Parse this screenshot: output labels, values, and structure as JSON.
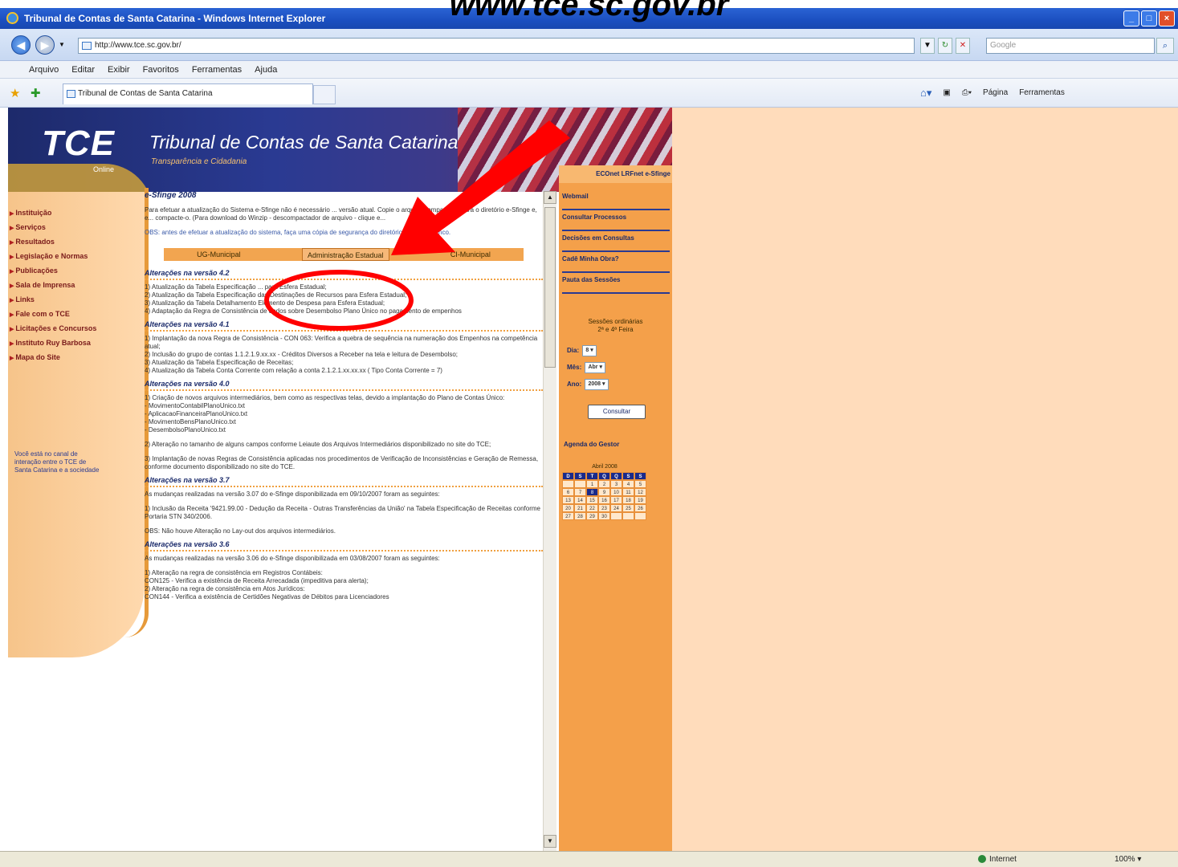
{
  "slide": {
    "caption": "www.tce.sc.gov.br"
  },
  "window": {
    "title": "Tribunal de Contas de Santa Catarina - Windows Internet Explorer",
    "min": "_",
    "max": "□",
    "close": "×"
  },
  "addressbar": {
    "url": "http://www.tce.sc.gov.br/",
    "search_placeholder": "Google"
  },
  "menu": [
    "Arquivo",
    "Editar",
    "Exibir",
    "Favoritos",
    "Ferramentas",
    "Ajuda"
  ],
  "tab": {
    "label": "Tribunal de Contas de Santa Catarina"
  },
  "commandbar": {
    "page": "Página",
    "tools": "Ferramentas"
  },
  "site": {
    "logo": "TCE",
    "online": "Online",
    "title": "Tribunal de Contas de Santa Catarina",
    "subtitle": "Transparência e Cidadania",
    "left_nav": [
      "Instituição",
      "Serviços",
      "Resultados",
      "Legislação e Normas",
      "Publicações",
      "Sala de Imprensa",
      "Links",
      "Fale com o TCE",
      "Licitações e Concursos",
      "Instituto Ruy Barbosa",
      "Mapa do Site"
    ],
    "left_message": "Você está no canal de interação entre o TCE de Santa Catarina e a sociedade",
    "content": {
      "title": "e-Sfinge 2008",
      "intro": "Para efetuar a atualização do Sistema e-Sfinge não é necessário ... versão atual. Copie o arquivo compactado para o diretório e-Sfinge e, e... compacte-o. (Para download do Winzip - descompactador de arquivo - clique e...",
      "obs": "OBS: antes de efetuar a atualização do sistema, faça uma cópia de segurança do diretório E-Sfinge/Banco.",
      "tabs": [
        "UG-Municipal",
        "Administração Estadual",
        "CI-Municipal"
      ],
      "sections": [
        {
          "heading": "Alterações na versão 4.2",
          "lines": [
            "1) Atualização da Tabela Especificação ... para Esfera Estadual;",
            "2) Atualização da Tabela Especificação das Destinações de Recursos para Esfera Estadual;",
            "3) Atualização da Tabela Detalhamento Elemento de Despesa para Esfera Estadual;",
            "4) Adaptação da Regra de Consistência de dados sobre Desembolso Plano Único no pagamento de empenhos"
          ]
        },
        {
          "heading": "Alterações na versão 4.1",
          "lines": [
            "1) Implantação da nova Regra de Consistência - CON 063: Verifica a quebra de sequência na numeração dos Empenhos na competência atual;",
            "2) Inclusão do grupo de contas 1.1.2.1.9.xx.xx - Créditos Diversos a Receber na tela e leitura de Desembolso;",
            "3) Atualização da Tabela Especificação de Receitas;",
            "4) Atualização da Tabela Conta Corrente com relação a conta 2.1.2.1.xx.xx.xx ( Tipo Conta Corrente = 7)"
          ]
        },
        {
          "heading": "Alterações na versão 4.0",
          "lines": [
            "1) Criação de novos arquivos intermediários, bem como as respectivas telas, devido a implantação do Plano de Contas Único:",
            "- MovimentoContabilPlanoUnico.txt",
            "- AplicacaoFinanceiraPlanoUnico.txt",
            "- MovimentoBensPlanoUnico.txt",
            "- DesembolsoPlanoUnico.txt",
            "",
            "2) Alteração no tamanho de alguns campos conforme Leiaute dos Arquivos Intermediários disponibilizado no site do TCE;",
            "",
            "3) Implantação de novas Regras de Consistência aplicadas nos procedimentos de Verificação de Inconsistências e Geração de Remessa, conforme documento disponibilizado no site do TCE."
          ]
        },
        {
          "heading": "Alterações na versão 3.7",
          "lines": [
            "As mudanças realizadas na versão 3.07 do e-Sfinge disponibilizada em 09/10/2007 foram as seguintes:",
            "",
            "1) Inclusão da Receita '9421.99.00 - Dedução da Receita - Outras Transferências da União' na Tabela Especificação de Receitas conforme Portaria STN 340/2006.",
            "",
            "OBS: Não houve Alteração no Lay-out dos arquivos intermediários."
          ]
        },
        {
          "heading": "Alterações na versão 3.6",
          "lines": [
            "As mudanças realizadas na versão 3.06 do e-Sfinge disponibilizada em 03/08/2007 foram as seguintes:",
            "",
            "1) Alteração na regra de consistência em Registros Contábeis:",
            "CON125 - Verifica a existência de Receita Arrecadada (impeditiva para alerta);",
            "2) Alteração na regra de consistência em Atos Jurídicos:",
            "CON144 - Verifica a existência de Certidões Negativas de Débitos para Licenciadores"
          ]
        }
      ]
    },
    "right": {
      "top_links": "ECOnet  LRFnet  e-Sfinge",
      "links": [
        "Webmail",
        "Consultar Processos",
        "Decisões em Consultas",
        "Cadê Minha Obra?",
        "Pauta das Sessões"
      ],
      "sessions_title": "Sessões ordinárias",
      "sessions_days": "2ª e 4ª Feira",
      "dia_label": "Dia:",
      "dia_value": "8",
      "mes_label": "Mês:",
      "mes_value": "Abr",
      "ano_label": "Ano:",
      "ano_value": "2008",
      "consultar": "Consultar",
      "agenda": "Agenda do Gestor",
      "calendar_month": "Abril 2008",
      "weekdays": [
        "D",
        "S",
        "T",
        "Q",
        "Q",
        "S",
        "S"
      ],
      "days": [
        "",
        "",
        "1",
        "2",
        "3",
        "4",
        "5",
        "6",
        "7",
        "8",
        "9",
        "10",
        "11",
        "12",
        "13",
        "14",
        "15",
        "16",
        "17",
        "18",
        "19",
        "20",
        "21",
        "22",
        "23",
        "24",
        "25",
        "26",
        "27",
        "28",
        "29",
        "30",
        "",
        "",
        ""
      ],
      "today": "8"
    }
  },
  "statusbar": {
    "zone": "Internet",
    "zoom": "100%"
  },
  "colors": {
    "annotation_red": "#ff0000",
    "page_bg": "#ffdcbb",
    "nav_text": "#7a1a1a",
    "link_blue": "#1a2a6a"
  }
}
